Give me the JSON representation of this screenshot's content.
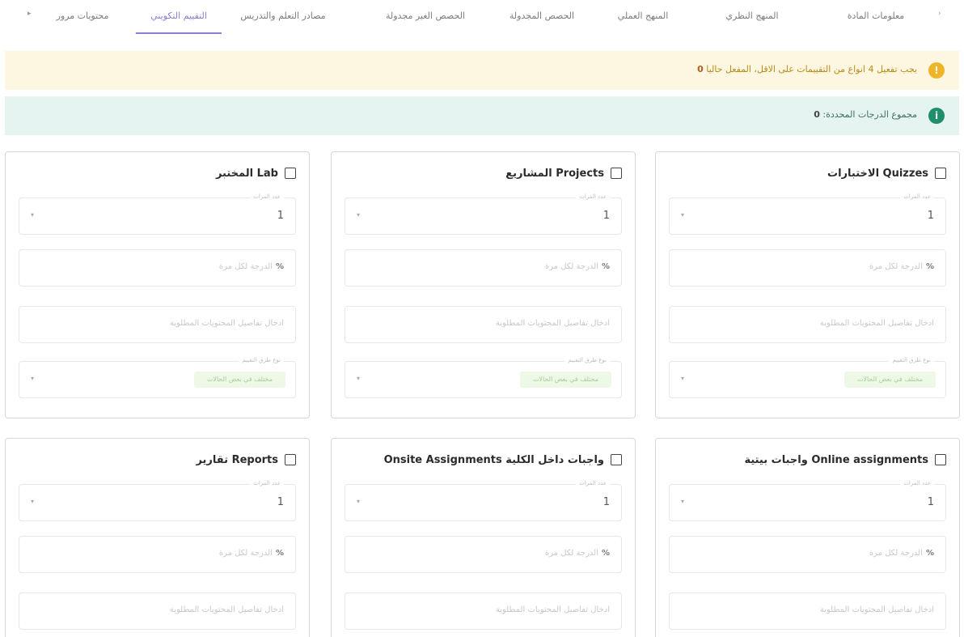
{
  "tabs": {
    "items": [
      {
        "label": "معلومات المادة"
      },
      {
        "label": "المنهج النظري"
      },
      {
        "label": "المنهج العملي"
      },
      {
        "label": "الحصص المجدولة"
      },
      {
        "label": "الحصص الغير مجدولة"
      },
      {
        "label": "مصادر التعلم والتدريس"
      },
      {
        "label": "التقييم التكويني"
      },
      {
        "label": "محتويات مرور"
      }
    ],
    "active_label": "التقييم التكويني"
  },
  "alerts": {
    "warning": {
      "text": "يجب تفعيل 4 انواع من التقييمات على الاقل، المفعل حاليا",
      "count": "0"
    },
    "info": {
      "text": "مجموع الدرجات المحددة:",
      "total": "0"
    }
  },
  "field_labels": {
    "count_label": "عدد المرات",
    "grade_placeholder": "الدرجة لكل مرة",
    "percent_symbol": "%",
    "notes_placeholder": "ادخال تفاصيل المحتويات المطلوبة",
    "type_label": "نوع طرق التقييم",
    "type_chip": "مختلف في بعض الحالات"
  },
  "cards": [
    {
      "title": "Quizzes الاختبارات",
      "count": "1"
    },
    {
      "title": "Projects المشاريع",
      "count": "1"
    },
    {
      "title": "Lab المختبر",
      "count": "1"
    },
    {
      "title": "Online assignments واجبات بيتية",
      "count": "1"
    },
    {
      "title": "واجبات داخل الكلية Onsite Assignments",
      "count": "1"
    },
    {
      "title": "Reports تقارير",
      "count": "1"
    }
  ]
}
